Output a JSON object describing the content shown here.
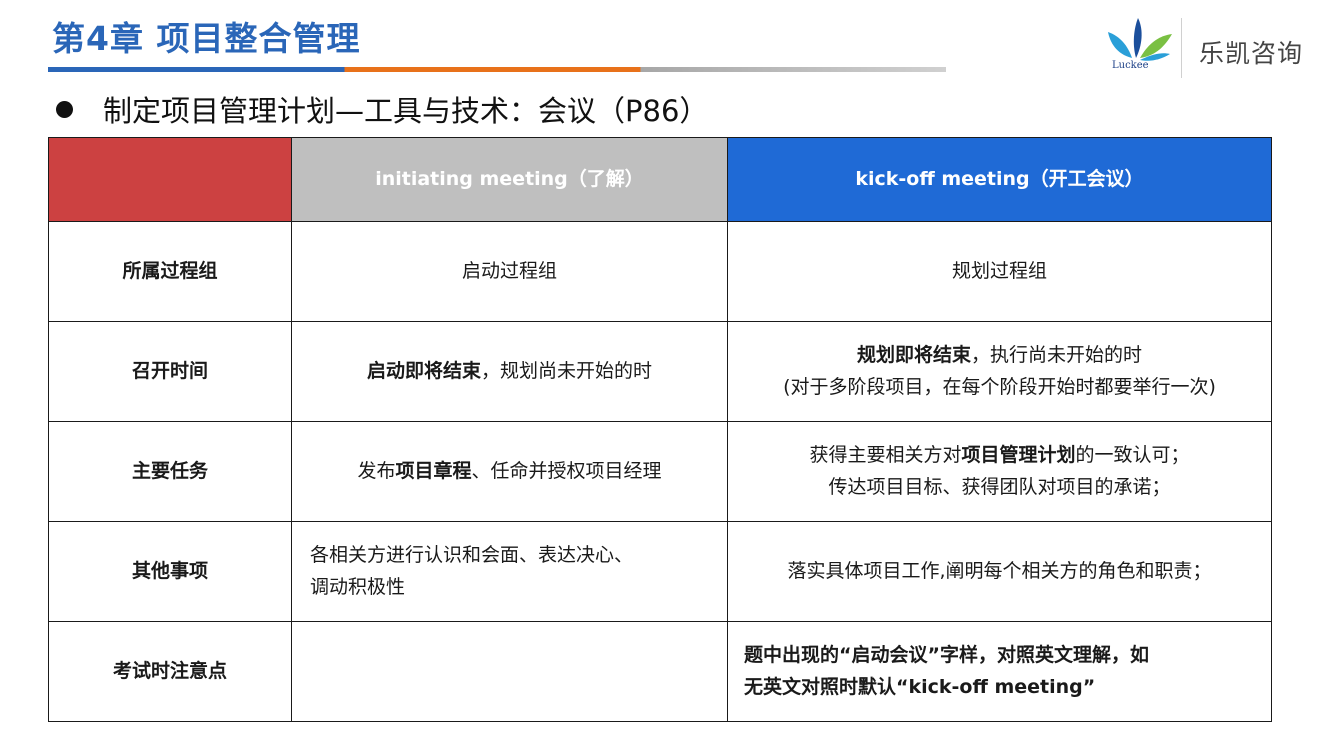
{
  "header": {
    "chapter_title": "第4章 项目整合管理",
    "company_name": "乐凯咨询",
    "logo_text": "Luckee"
  },
  "subtitle": "制定项目管理计划—工具与技术：会议（P86）",
  "table": {
    "columns": {
      "initiating": "initiating meeting（了解）",
      "kickoff": "kick-off meeting（开工会议）"
    },
    "rows": {
      "process_group": {
        "label": "所属过程组",
        "initiating": "启动过程组",
        "kickoff": "规划过程组"
      },
      "timing": {
        "label": "召开时间",
        "initiating_bold": "启动即将结束",
        "initiating_rest": "，规划尚未开始的时",
        "kickoff_bold": "规划即将结束",
        "kickoff_rest": "，执行尚未开始的时",
        "kickoff_note": "(对于多阶段项目，在每个阶段开始时都要举行一次)"
      },
      "main_tasks": {
        "label": "主要任务",
        "initiating_pre": "发布",
        "initiating_bold": "项目章程",
        "initiating_post": "、任命并授权项目经理",
        "kickoff_line1_pre": "获得主要相关方对",
        "kickoff_line1_bold": "项目管理计划",
        "kickoff_line1_post": "的一致认可；",
        "kickoff_line2": "传达项目目标、获得团队对项目的承诺；"
      },
      "other_items": {
        "label": "其他事项",
        "initiating_line1": "各相关方进行认识和会面、表达决心、",
        "initiating_line2": "调动积极性",
        "kickoff": "落实具体项目工作,阐明每个相关方的角色和职责；"
      },
      "exam_notes": {
        "label": "考试时注意点",
        "initiating": "",
        "kickoff_line1": "题中出现的“启动会议”字样，对照英文理解，如",
        "kickoff_line2": "无英文对照时默认“kick-off meeting”"
      }
    }
  },
  "colors": {
    "title_blue": "#2a66b8",
    "header_red": "#cc4141",
    "header_gray": "#bfbfbf",
    "header_blue": "#1f6ad6"
  }
}
